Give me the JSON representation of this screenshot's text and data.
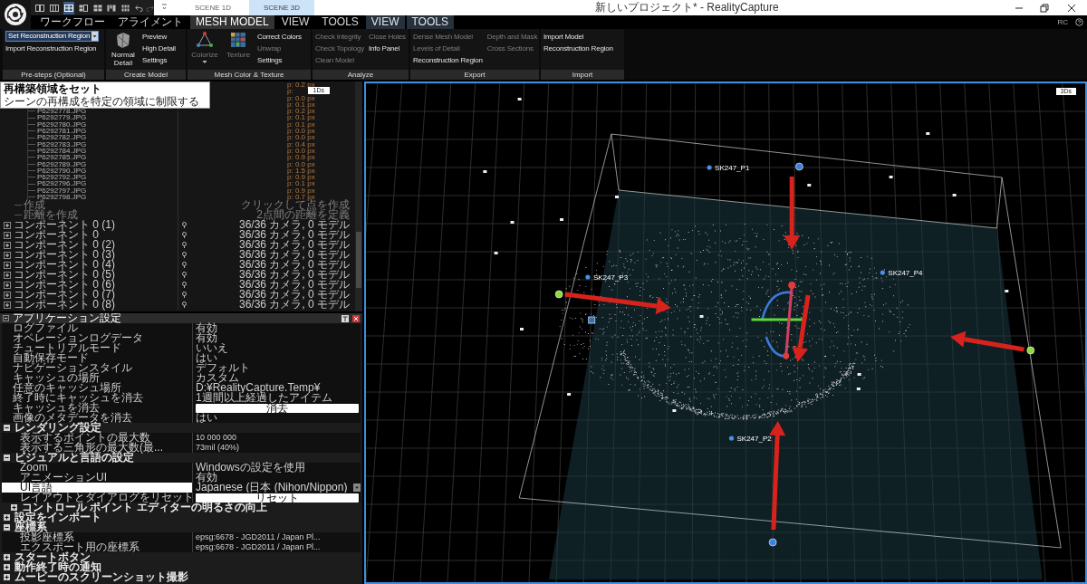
{
  "title_bar": {
    "layout_buttons": [
      {
        "selected": false
      },
      {
        "selected": false
      },
      {
        "selected": true
      },
      {
        "selected": false
      },
      {
        "selected": false
      },
      {
        "selected": false
      },
      {
        "selected": false
      }
    ],
    "scene_tabs": [
      {
        "label": "SCENE 1D",
        "selected": false
      },
      {
        "label": "SCENE 3D",
        "selected": true
      }
    ],
    "title": "新しいプロジェクト* - RealityCapture"
  },
  "menu_tabs": [
    {
      "label": "ワークフロー",
      "kind": "main",
      "selected": false
    },
    {
      "label": "アライメント",
      "kind": "main",
      "selected": false
    },
    {
      "label": "MESH MODEL",
      "kind": "main",
      "selected": true
    },
    {
      "label": "VIEW",
      "kind": "main",
      "selected": false
    },
    {
      "label": "TOOLS",
      "kind": "main",
      "selected": false
    },
    {
      "label": "VIEW",
      "kind": "context",
      "selected": false
    },
    {
      "label": "TOOLS",
      "kind": "context",
      "selected": false
    }
  ],
  "menu_badge": "RC",
  "ribbon": [
    {
      "label": "Pre-steps (Optional)",
      "columns": [
        [
          {
            "label": "Set Reconstruction Region",
            "kind": "dropdown",
            "disabled": false
          },
          {
            "label": "Import Reconstruction Region",
            "kind": "text",
            "disabled": false
          }
        ]
      ]
    },
    {
      "label": "Create Model",
      "columns": [
        [
          {
            "label": "Normal Detail",
            "kind": "large",
            "disabled": false
          }
        ],
        [
          {
            "label": "Preview",
            "kind": "text",
            "disabled": false
          },
          {
            "label": "High Detail",
            "kind": "text",
            "disabled": false
          },
          {
            "label": "Settings",
            "kind": "text",
            "disabled": false
          }
        ]
      ]
    },
    {
      "label": "Mesh Color & Texture",
      "columns": [
        [
          {
            "label": "Colorize",
            "kind": "large_menu",
            "disabled": true
          }
        ],
        [
          {
            "label": "Texture",
            "kind": "large",
            "disabled": true
          }
        ],
        [
          {
            "label": "Correct Colors",
            "kind": "text",
            "disabled": false
          },
          {
            "label": "Unwrap",
            "kind": "text",
            "disabled": true
          },
          {
            "label": "Settings",
            "kind": "text",
            "disabled": false
          }
        ]
      ]
    },
    {
      "label": "Analyze",
      "columns": [
        [
          {
            "label": "Check Integrity",
            "kind": "text",
            "disabled": true
          },
          {
            "label": "Check Topology",
            "kind": "text",
            "disabled": true
          },
          {
            "label": "Clean Model",
            "kind": "text",
            "disabled": true
          }
        ],
        [
          {
            "label": "Close Holes",
            "kind": "text",
            "disabled": true
          },
          {
            "label": "Info Panel",
            "kind": "text",
            "disabled": false
          }
        ]
      ]
    },
    {
      "label": "Export",
      "columns": [
        [
          {
            "label": "Dense Mesh Model",
            "kind": "text",
            "disabled": true
          },
          {
            "label": "Levels of Detail",
            "kind": "text",
            "disabled": true
          },
          {
            "label": "Reconstruction Region",
            "kind": "text",
            "disabled": false
          }
        ],
        [
          {
            "label": "Depth and Mask",
            "kind": "text",
            "disabled": true
          },
          {
            "label": "Cross Sections",
            "kind": "text",
            "disabled": true
          }
        ]
      ]
    },
    {
      "label": "Import",
      "columns": [
        [
          {
            "label": "Import Model",
            "kind": "text",
            "disabled": false
          },
          {
            "label": "Reconstruction Region",
            "kind": "text",
            "disabled": false
          }
        ]
      ]
    }
  ],
  "tooltip": {
    "title": "再構築領域をセット",
    "text": "シーンの再構成を特定の領域に制限する"
  },
  "tree": {
    "badge": "1Ds",
    "images": [
      {
        "value": "p: 0.2 px"
      },
      {
        "value": "p:"
      },
      {
        "value": "p: 0.0 px"
      },
      {
        "value": "p: 0.1 px"
      },
      {
        "name": "P6292778.JPG",
        "value": "p: 0.2 px"
      },
      {
        "name": "P6292779.JPG",
        "value": "p: 0.1 px"
      },
      {
        "name": "P6292780.JPG",
        "value": "p: 0.1 px"
      },
      {
        "name": "P6292781.JPG",
        "value": "p: 0.0 px"
      },
      {
        "name": "P6292782.JPG",
        "value": "p: 0.0 px"
      },
      {
        "name": "P6292783.JPG",
        "value": "p: 0.4 px"
      },
      {
        "name": "P6292784.JPG",
        "value": "p: 0.0 px"
      },
      {
        "name": "P6292785.JPG",
        "value": "p: 0.9 px"
      },
      {
        "name": "P6292789.JPG",
        "value": "p: 0.0 px"
      },
      {
        "name": "P6292790.JPG",
        "value": "p: 1.5 px"
      },
      {
        "name": "P6292792.JPG",
        "value": "p: 0.9 px"
      },
      {
        "name": "P6292796.JPG",
        "value": "p: 0.1 px"
      },
      {
        "name": "P6292797.JPG",
        "value": "p: 0.9 px"
      },
      {
        "name": "P6292798.JPG",
        "value": "p: 0.7 px"
      }
    ],
    "tools": [
      {
        "label": "作成",
        "hint": "クリックして点を作成"
      },
      {
        "label": "距離を作成",
        "hint": "2点間の距離を定義"
      }
    ],
    "components": [
      {
        "label": "コンポーネント 0 (1)",
        "summary": "36/36 カメラ, 0 モデル",
        "expanded": false
      },
      {
        "label": "コンポーネント 0",
        "summary": "36/36 カメラ, 0 モデル",
        "expanded": false
      },
      {
        "label": "コンポーネント 0 (2)",
        "summary": "36/36 カメラ, 0 モデル",
        "expanded": false
      },
      {
        "label": "コンポーネント 0 (3)",
        "summary": "36/36 カメラ, 0 モデル",
        "expanded": false
      },
      {
        "label": "コンポーネント 0 (4)",
        "summary": "36/36 カメラ, 0 モデル",
        "expanded": false
      },
      {
        "label": "コンポーネント 0 (5)",
        "summary": "36/36 カメラ, 0 モデル",
        "expanded": false
      },
      {
        "label": "コンポーネント 0 (6)",
        "summary": "36/36 カメラ, 0 モデル",
        "expanded": false
      },
      {
        "label": "コンポーネント 0 (7)",
        "summary": "36/36 カメラ, 0 モデル",
        "expanded": false
      },
      {
        "label": "コンポーネント 0 (8)",
        "summary": "36/36 カメラ, 0 モデル",
        "expanded": false
      }
    ]
  },
  "settings_panel": {
    "title": "アプリケーション設定",
    "items": [
      {
        "kind": "row",
        "key": "ログファイル",
        "value": {
          "kind": "text",
          "text": "有効"
        },
        "selected": false
      },
      {
        "kind": "row",
        "key": "オペレーションログデータ",
        "value": {
          "kind": "text",
          "text": "有効"
        },
        "selected": false
      },
      {
        "kind": "row",
        "key": "チュートリアルモード",
        "value": {
          "kind": "text",
          "text": "いいえ"
        },
        "selected": false
      },
      {
        "kind": "row",
        "key": "自動保存モード",
        "value": {
          "kind": "text",
          "text": "はい"
        },
        "selected": false
      },
      {
        "kind": "row",
        "key": "ナビゲーションスタイル",
        "value": {
          "kind": "text",
          "text": "デフォルト"
        },
        "selected": false
      },
      {
        "kind": "row",
        "key": "キャッシュの場所",
        "value": {
          "kind": "text",
          "text": "カスタム"
        },
        "selected": false
      },
      {
        "kind": "row",
        "key": "任意のキャッシュ場所",
        "value": {
          "kind": "text",
          "text": "D:¥RealityCapture.Temp¥"
        },
        "selected": false
      },
      {
        "kind": "row",
        "key": "終了時にキャッシュを消去",
        "value": {
          "kind": "text",
          "text": "1週間以上経過したアイテム"
        },
        "selected": false
      },
      {
        "kind": "row",
        "key": "キャッシュを消去",
        "value": {
          "kind": "button",
          "text": "消去"
        },
        "selected": false
      },
      {
        "kind": "row",
        "key": "画像のメタデータを消去",
        "value": {
          "kind": "text",
          "text": "はい"
        },
        "selected": false
      },
      {
        "kind": "section",
        "label": "レンダリング設定",
        "expanded": true,
        "children": [
          {
            "kind": "row",
            "key": "表示するポイントの最大数",
            "value": {
              "kind": "text",
              "text": "10 000 000"
            },
            "selected": false
          },
          {
            "kind": "row",
            "key": "表示する三角形の最大数(最...",
            "value": {
              "kind": "text",
              "text": "73mil (40%)"
            },
            "selected": false
          }
        ]
      },
      {
        "kind": "section",
        "label": "ビジュアルと言語の設定",
        "expanded": true,
        "children": [
          {
            "kind": "row",
            "key": "Zoom",
            "value": {
              "kind": "text",
              "text": "Windowsの設定を使用"
            },
            "selected": false
          },
          {
            "kind": "row",
            "key": "アニメーションUI",
            "value": {
              "kind": "text",
              "text": "有効"
            },
            "selected": false
          },
          {
            "kind": "row",
            "key": "UI言語",
            "value": {
              "kind": "dropdown",
              "text": "Japanese (日本 (Nihon/Nippon)"
            },
            "selected": true
          },
          {
            "kind": "row",
            "key": "レイアウトとダイアログをリセット",
            "value": {
              "kind": "button",
              "text": "リセット"
            },
            "selected": false
          },
          {
            "kind": "section",
            "label": "コントロール ポイント エディターの明るさの向上",
            "expanded": false
          }
        ]
      },
      {
        "kind": "section",
        "label": "設定をインポート",
        "expanded": false
      },
      {
        "kind": "section",
        "label": "座標系",
        "expanded": true,
        "children": [
          {
            "kind": "row",
            "key": "投影座標系",
            "value": {
              "kind": "text",
              "text": "epsg:6678 - JGD2011 / Japan Pl..."
            },
            "selected": false
          },
          {
            "kind": "row",
            "key": "エクスポート用の座標系",
            "value": {
              "kind": "text",
              "text": "epsg:6678 - JGD2011 / Japan Pl..."
            },
            "selected": false
          }
        ]
      },
      {
        "kind": "section",
        "label": "スタートボタン",
        "expanded": false
      },
      {
        "kind": "section",
        "label": "動作終了時の通知",
        "expanded": false
      },
      {
        "kind": "section",
        "label": "ムービーのスクリーンショット撮影",
        "expanded": false
      }
    ]
  },
  "viewport": {
    "badge": "3Ds",
    "control_points": [
      {
        "label": "SK247_P1"
      },
      {
        "label": "SK247_P4"
      },
      {
        "label": "SK247_P3"
      },
      {
        "label": "SK247_P2"
      }
    ]
  }
}
